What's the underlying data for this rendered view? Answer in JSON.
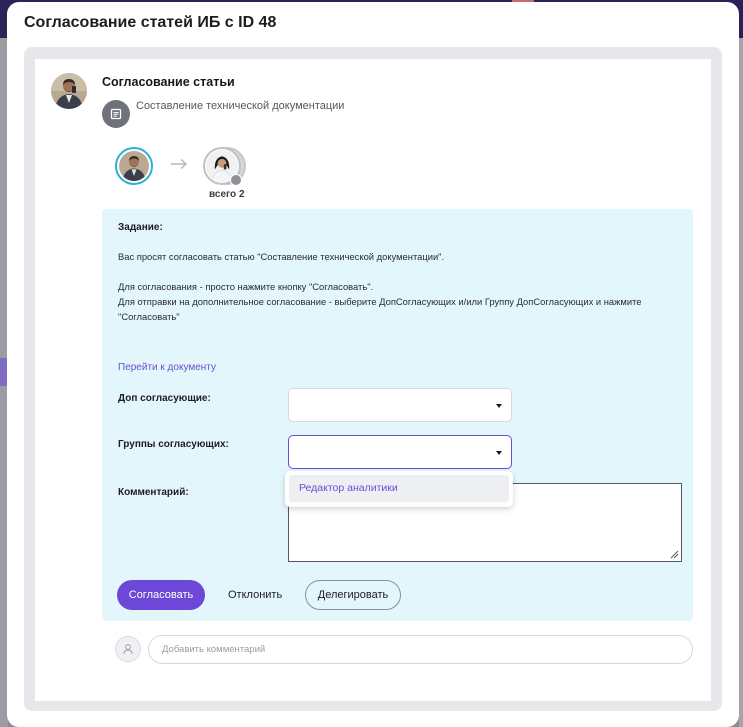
{
  "modal": {
    "title": "Согласование статей ИБ с ID 48"
  },
  "article": {
    "heading": "Согласование статьи",
    "document_name": "Составление технической документации"
  },
  "route": {
    "total_label": "всего 2"
  },
  "task": {
    "heading": "Задание:",
    "line1": "Вас просят согласовать статью \"Составление технической документации\".",
    "line2": "Для согласования - просто нажмите кнопку \"Согласовать\".",
    "line3": "Для отправки на дополнительное согласование - выберите ДопСогласующих и/или Группу ДопСогласующих и нажмите",
    "line4": "\"Согласовать\"",
    "doc_link": "Перейти к документу"
  },
  "fields": {
    "extra_approvers_label": "Доп согласующие:",
    "approver_groups_label": "Группы согласующих:",
    "comment_label": "Комментарий:"
  },
  "dropdown": {
    "options": [
      "Редактор аналитики"
    ]
  },
  "actions": {
    "approve": "Согласовать",
    "reject": "Отклонить",
    "delegate": "Делегировать"
  },
  "composer": {
    "placeholder": "Добавить комментарий"
  },
  "colors": {
    "accent": "#6d48d8",
    "task_bg": "#e3f6fb",
    "route_ring": "#2bb1d8"
  }
}
